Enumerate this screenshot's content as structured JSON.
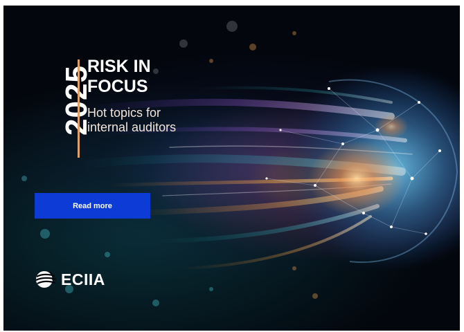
{
  "banner": {
    "year": "2025",
    "heading": "RISK IN FOCUS",
    "subtitle": "Hot topics for internal auditors",
    "cta_label": "Read more",
    "brand_name": "ECIIA",
    "colors": {
      "accent_divider": "#e0a267",
      "cta_background": "#0d3bd6",
      "text": "#ffffff",
      "background": "#03060d"
    },
    "icons": [
      "globe-network-art",
      "eciia-globe-logo-icon"
    ]
  }
}
